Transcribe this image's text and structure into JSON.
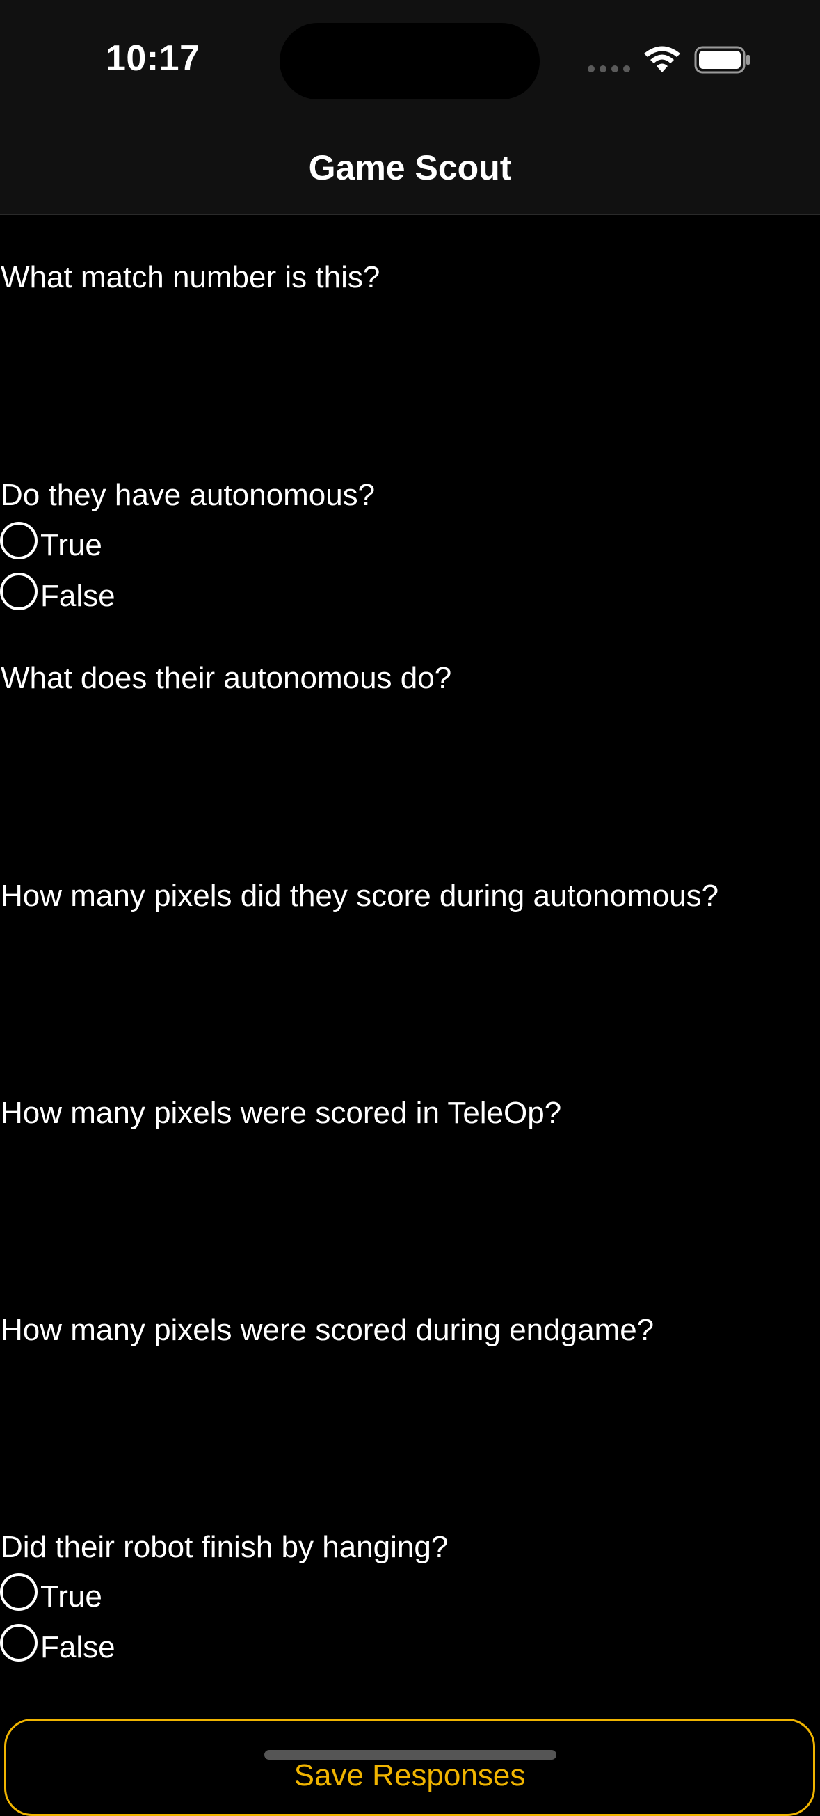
{
  "status_bar": {
    "time": "10:17",
    "icons": [
      "cellular-signal-icon",
      "wifi-icon",
      "battery-icon"
    ]
  },
  "nav": {
    "title": "Game Scout"
  },
  "form": {
    "q_match_number": "What match number is this?",
    "q_autonomous": "Do they have autonomous?",
    "q_autonomous_options": [
      "True",
      "False"
    ],
    "q_auto_description": "What does their autonomous do?",
    "q_auto_pixels": "How many pixels did they score during autonomous?",
    "q_teleop_pixels": "How many pixels were scored in TeleOp?",
    "q_endgame_pixels": "How many pixels were scored during endgame?",
    "q_hanging": "Did their robot finish by hanging?",
    "q_hanging_options": [
      "True",
      "False"
    ]
  },
  "save_button": {
    "label": "Save Responses"
  },
  "colors": {
    "background": "#000000",
    "accent": "#f0b400",
    "bar": "#111111"
  }
}
